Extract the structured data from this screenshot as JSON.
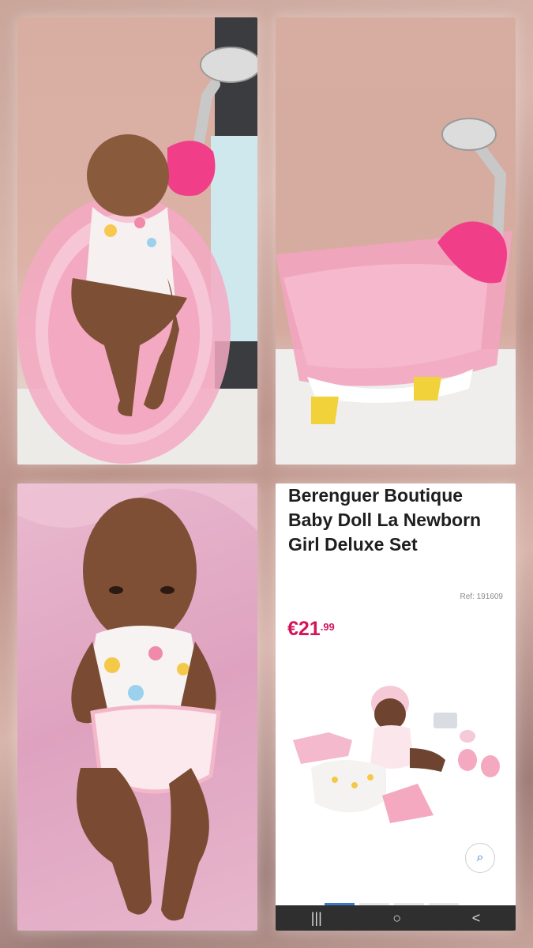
{
  "product": {
    "title": "Berenguer Boutique Baby Doll La Newborn Girl Deluxe Set",
    "ref": "Ref: 191609",
    "price_main": "€21",
    "price_cents": ".99"
  },
  "nav": {
    "recents_icon": "|||",
    "home_icon": "○",
    "back_icon": "<"
  },
  "zoom_icon": "zoom-in-icon"
}
